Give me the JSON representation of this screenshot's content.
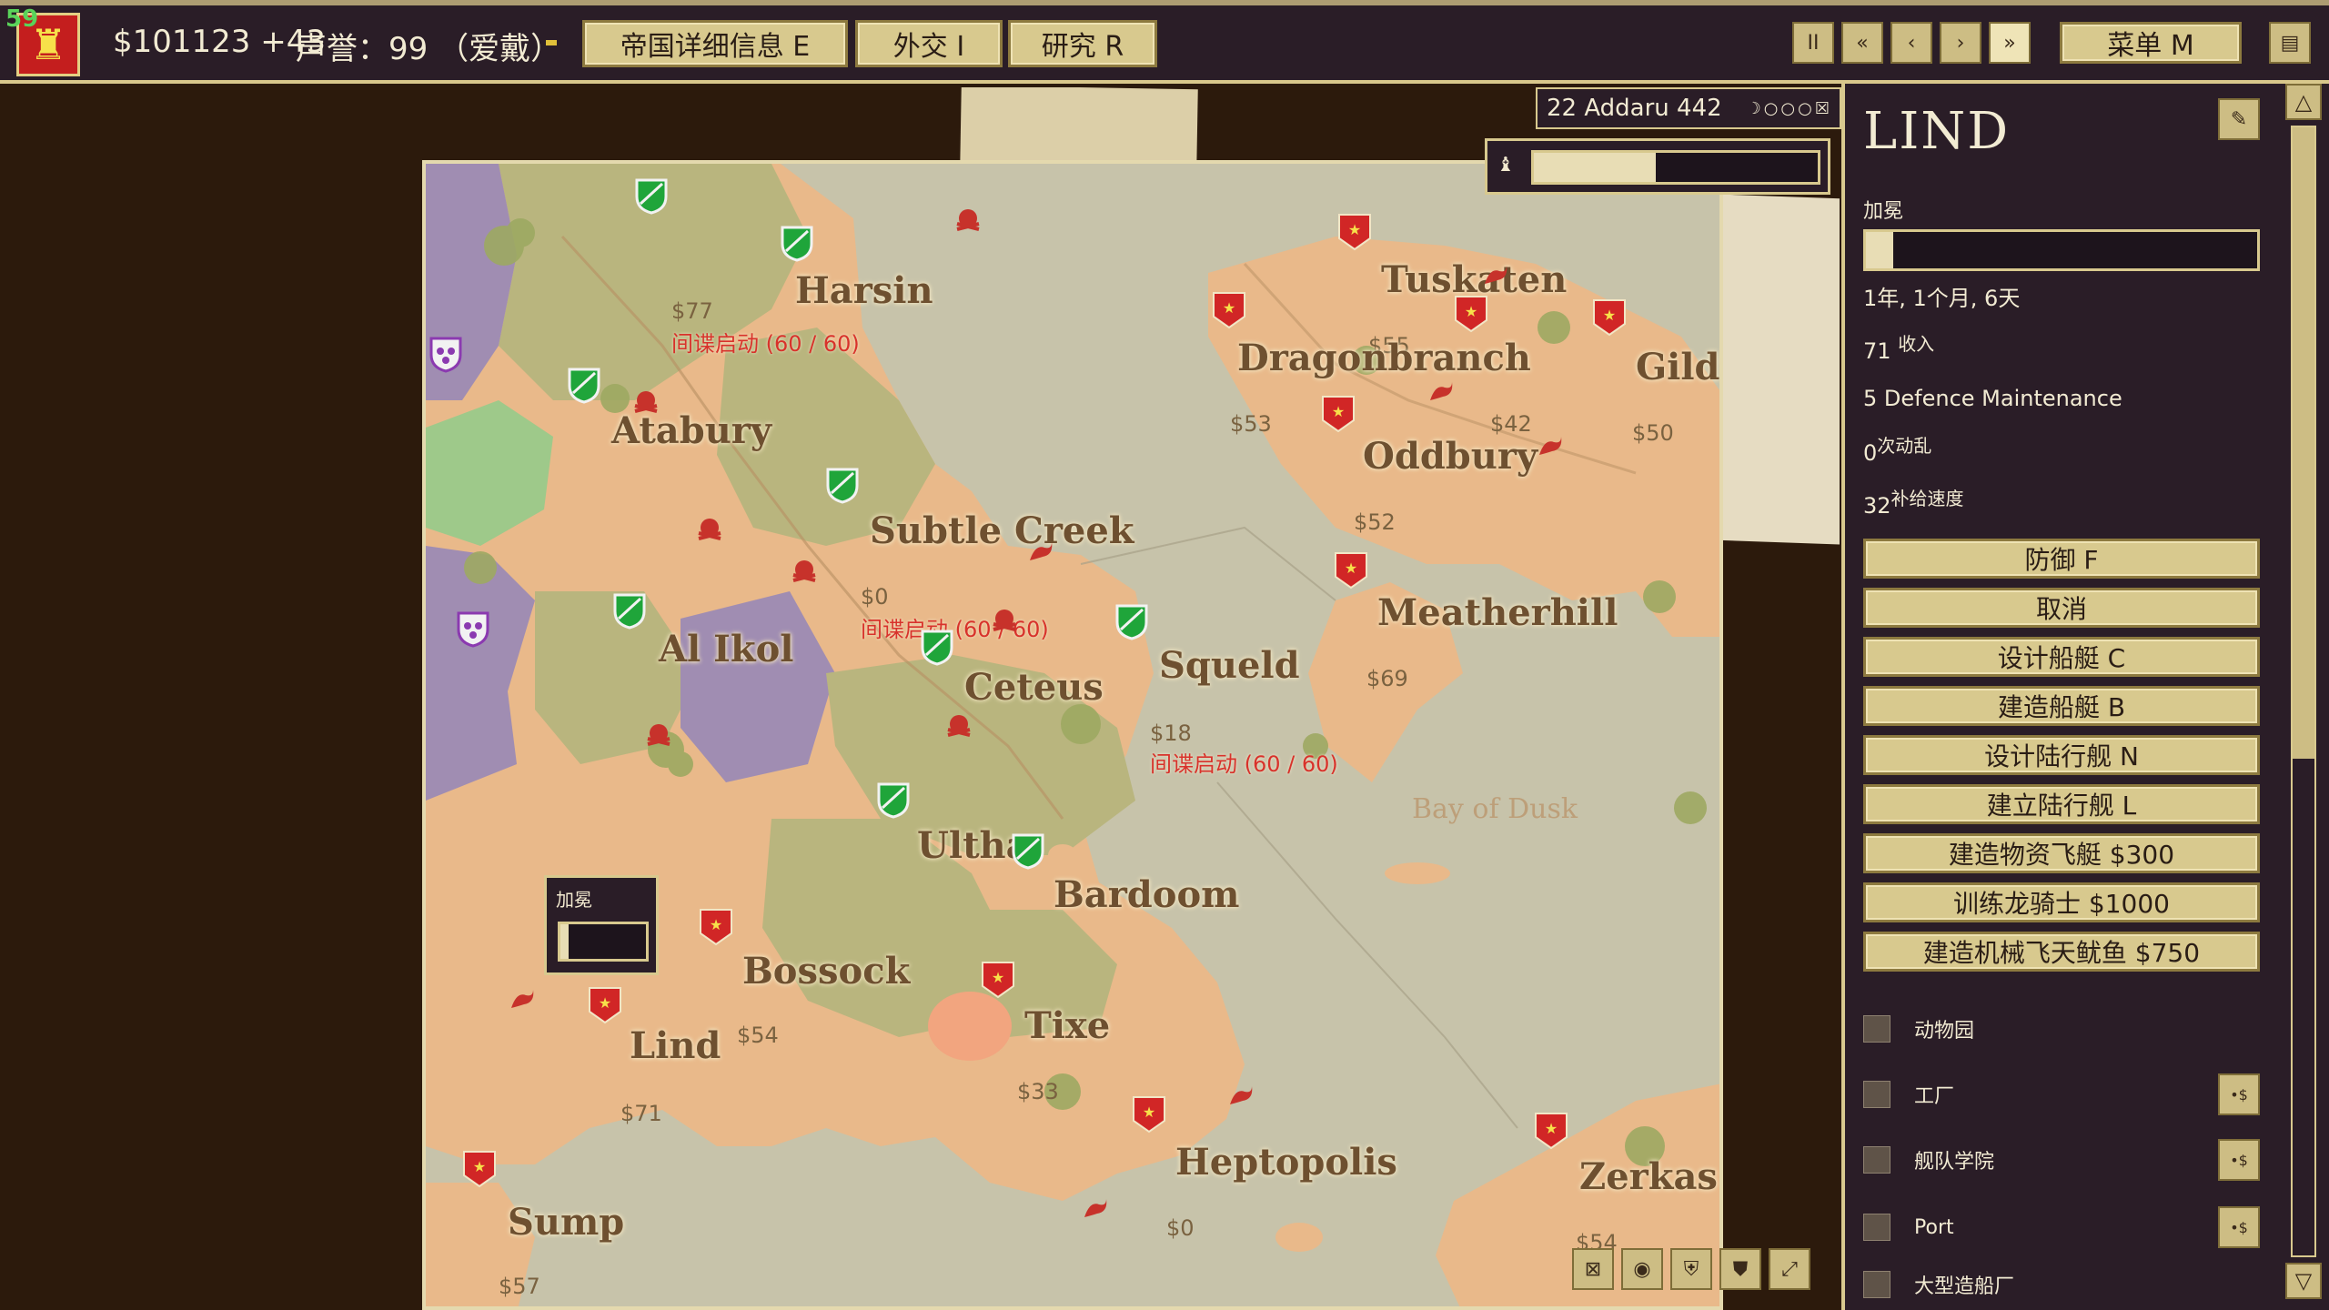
{
  "hud": {
    "fps": "59",
    "money": "$101123 +43",
    "prestige": "声誉：99 （爱戴）",
    "buttons": {
      "empire": "帝国详细信息 E",
      "diplomacy": "外交 I",
      "research": "研究 R",
      "menu": "菜单 M"
    },
    "speed": {
      "pause": "II",
      "slowest": "«",
      "slow": "‹",
      "normal": "›",
      "fast": "»"
    },
    "book": "▤"
  },
  "date": {
    "text": "22 Addaru 442",
    "icons": "☽○○○☒"
  },
  "progress": {
    "icon": "♝",
    "value": 0.43
  },
  "map": {
    "cities": [
      {
        "name": "Harsin",
        "price": "$77",
        "spy": "间谍启动 (60 / 60)"
      },
      {
        "name": "Atabury",
        "price": "",
        "spy": ""
      },
      {
        "name": "Al Ikol",
        "price": "",
        "spy": ""
      },
      {
        "name": "Subtle Creek",
        "price": "$0",
        "spy": "间谍启动 (60 / 60)"
      },
      {
        "name": "Ceteus",
        "price": "",
        "spy": ""
      },
      {
        "name": "Squeld",
        "price": "$18",
        "spy": "间谍启动 (60 / 60)"
      },
      {
        "name": "Tuskaten",
        "price": "$55",
        "spy": ""
      },
      {
        "name": "Dragonbranch",
        "price": "$53",
        "spy": ""
      },
      {
        "name": "Gildfield",
        "price": "$50",
        "spy": ""
      },
      {
        "name": "Oddbury",
        "price": "$42",
        "spy": ""
      },
      {
        "name": "Meatherhill",
        "price": "$69",
        "spy": ""
      },
      {
        "name": "Ultha",
        "price": "",
        "spy": ""
      },
      {
        "name": "Bardoom",
        "price": "",
        "spy": ""
      },
      {
        "name": "Bossock",
        "price": "$54",
        "spy": ""
      },
      {
        "name": "Lind",
        "price": "$71",
        "spy": ""
      },
      {
        "name": "Tixe",
        "price": "$33",
        "spy": ""
      },
      {
        "name": "Heptopolis",
        "price": "$0",
        "spy": ""
      },
      {
        "name": "Sump",
        "price": "$57",
        "spy": ""
      },
      {
        "name": "Zerkas",
        "price": "$54",
        "spy": ""
      }
    ],
    "extra_prices": [
      "$52"
    ],
    "bay": "Bay of Dusk",
    "mini_popup": {
      "label": "加冕",
      "value": 0.1
    },
    "tools": [
      "⊠",
      "◉",
      "⛨",
      "⛊",
      "⤢"
    ]
  },
  "panel": {
    "title": "LIND",
    "edit_icon": "✎",
    "fog_label": "加冕",
    "fog_value": 0.07,
    "duration": "1年, 1个月, 6天",
    "income_value": "71",
    "income_label": "收入",
    "defence": "5 Defence Maintenance",
    "unrest_value": "0",
    "unrest_label": "次动乱",
    "supply_value": "32",
    "supply_label": "补给速度",
    "actions": [
      "防御 F",
      "取消",
      "设计船艇 C",
      "建造船艇 B",
      "设计陆行舰 N",
      "建立陆行舰 L",
      "建造物资飞艇 $300",
      "训练龙骑士 $1000",
      "建造机械飞天鱿鱼 $750"
    ],
    "buildings": [
      {
        "name": "动物园",
        "button": ""
      },
      {
        "name": "工厂",
        "button": "•$"
      },
      {
        "name": "舰队学院",
        "button": "•$"
      },
      {
        "name": "Port",
        "button": "•$"
      },
      {
        "name": "大型造船厂",
        "button": ""
      }
    ],
    "scroll_up": "△",
    "scroll_down": "▽"
  },
  "colors": {
    "ui_bg": "#2a1d27",
    "ui_border": "#d8c98e",
    "button": "#d8c98e",
    "sea": "#c7c3aa",
    "land_tan": "#e9b98a",
    "land_olive": "#b9b57e",
    "land_purple": "#a08db2",
    "land_green": "#9ec98a",
    "city_text": "#6e5030",
    "spy_text": "#d8322b",
    "player_flag": "#d12626",
    "ally_shield": "#1fa53a"
  }
}
